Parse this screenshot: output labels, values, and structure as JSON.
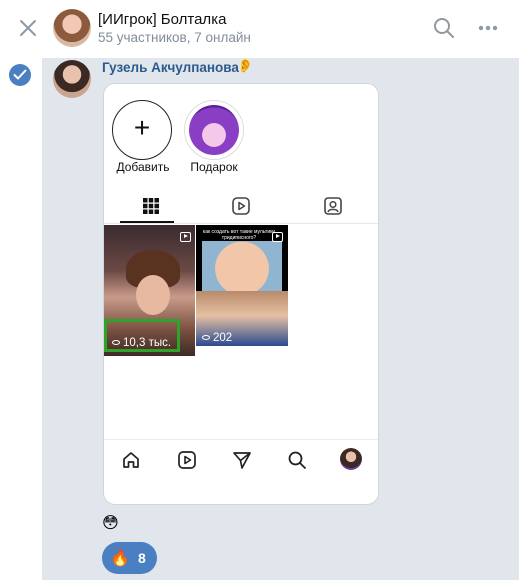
{
  "header": {
    "title": "[ИИгрок] Болталка",
    "subtitle": "55 участников, 7 онлайн"
  },
  "message": {
    "sender_name": "Гузель Акчулпанова",
    "sender_emoji": "👂",
    "selected": true,
    "emoji": "😳",
    "reaction": {
      "emoji": "🔥",
      "count": "8"
    }
  },
  "embedded_profile": {
    "stories": [
      {
        "label": "Добавить"
      },
      {
        "label": "Подарок"
      }
    ],
    "active_tab": "grid",
    "posts": [
      {
        "views": "10,3 тыс.",
        "highlighted": true
      },
      {
        "views": "202",
        "caption": "как создать вот такие мультики тридиписного?"
      }
    ]
  },
  "colors": {
    "accent": "#4a7fc1",
    "selection_bg": "#e1e6ec",
    "highlight_box": "#2ea328",
    "sender_name": "#2c5a8c"
  }
}
